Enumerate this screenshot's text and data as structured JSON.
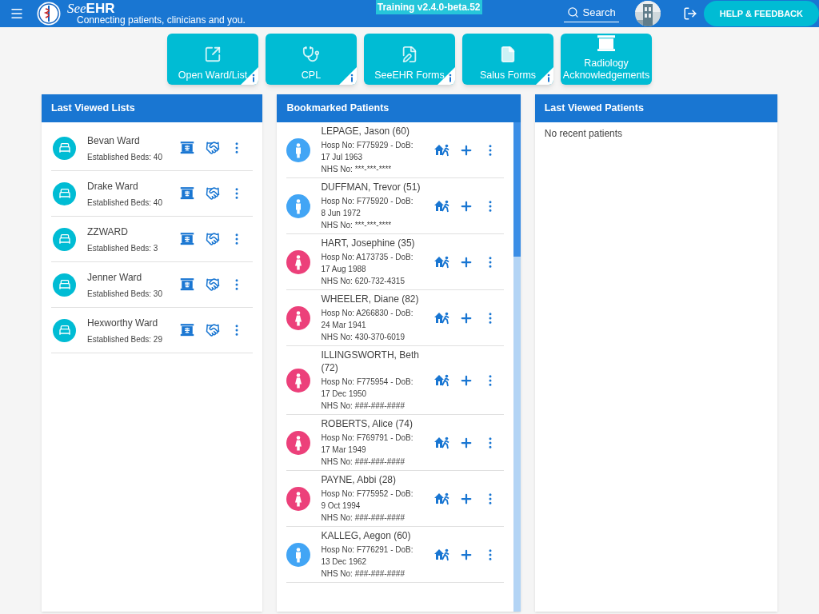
{
  "header": {
    "brand_prefix": "See",
    "brand_suffix": "EHR",
    "tagline": "Connecting patients, clinicians and you.",
    "environment": "Training v2.4.0-beta.52",
    "search": "Search",
    "help": "HELP & FEEDBACK"
  },
  "tiles": [
    {
      "kind": "open",
      "label": "Open Ward/List",
      "info": true
    },
    {
      "kind": "cpl",
      "label": "CPL",
      "info": true
    },
    {
      "kind": "forms",
      "label": "SeeEHR Forms",
      "info": true
    },
    {
      "kind": "file",
      "label": "Salus Forms",
      "info": true
    },
    {
      "kind": "radiology",
      "label": "Radiology Acknowledgements",
      "info": false
    }
  ],
  "last_viewed_lists": {
    "title": "Last Viewed Lists",
    "items": [
      {
        "name": "Bevan Ward",
        "beds": "Established Beds: 40"
      },
      {
        "name": "Drake Ward",
        "beds": "Established Beds: 40"
      },
      {
        "name": "ZZWARD",
        "beds": "Established Beds: 3"
      },
      {
        "name": "Jenner Ward",
        "beds": "Established Beds: 30"
      },
      {
        "name": "Hexworthy Ward",
        "beds": "Established Beds: 29"
      }
    ]
  },
  "bookmarked_patients": {
    "title": "Bookmarked Patients",
    "items": [
      {
        "name": "LEPAGE, Jason (60)",
        "kind": "male",
        "hosp": "Hosp No: F775929 - DoB: 17 Jul 1963",
        "nhs": "NHS No: ***-***-****"
      },
      {
        "name": "DUFFMAN, Trevor (51)",
        "kind": "male",
        "hosp": "Hosp No: F775920 - DoB: 8 Jun 1972",
        "nhs": "NHS No: ***-***-****"
      },
      {
        "name": "HART, Josephine (35)",
        "kind": "female",
        "hosp": "Hosp No: A173735 - DoB: 17 Aug 1988",
        "nhs": "NHS No: 620-732-4315"
      },
      {
        "name": "WHEELER, Diane (82)",
        "kind": "female",
        "hosp": "Hosp No: A266830 - DoB: 24 Mar 1941",
        "nhs": "NHS No: 430-370-6019"
      },
      {
        "name": "ILLINGSWORTH, Beth (72)",
        "kind": "female",
        "hosp": "Hosp No: F775954 - DoB: 17 Dec 1950",
        "nhs": "NHS No: ###-###-####"
      },
      {
        "name": "ROBERTS, Alice (74)",
        "kind": "female",
        "hosp": "Hosp No: F769791 - DoB: 17 Mar 1949",
        "nhs": "NHS No: ###-###-####"
      },
      {
        "name": "PAYNE, Abbi (28)",
        "kind": "female",
        "hosp": "Hosp No: F775952 - DoB: 9 Oct 1994",
        "nhs": "NHS No: ###-###-####"
      },
      {
        "name": "KALLEG, Aegon (60)",
        "kind": "male",
        "hosp": "Hosp No: F776291 - DoB: 13 Dec 1962",
        "nhs": "NHS No: ###-###-####"
      }
    ]
  },
  "last_viewed_patients": {
    "title": "Last Viewed Patients",
    "empty": "No recent patients"
  }
}
